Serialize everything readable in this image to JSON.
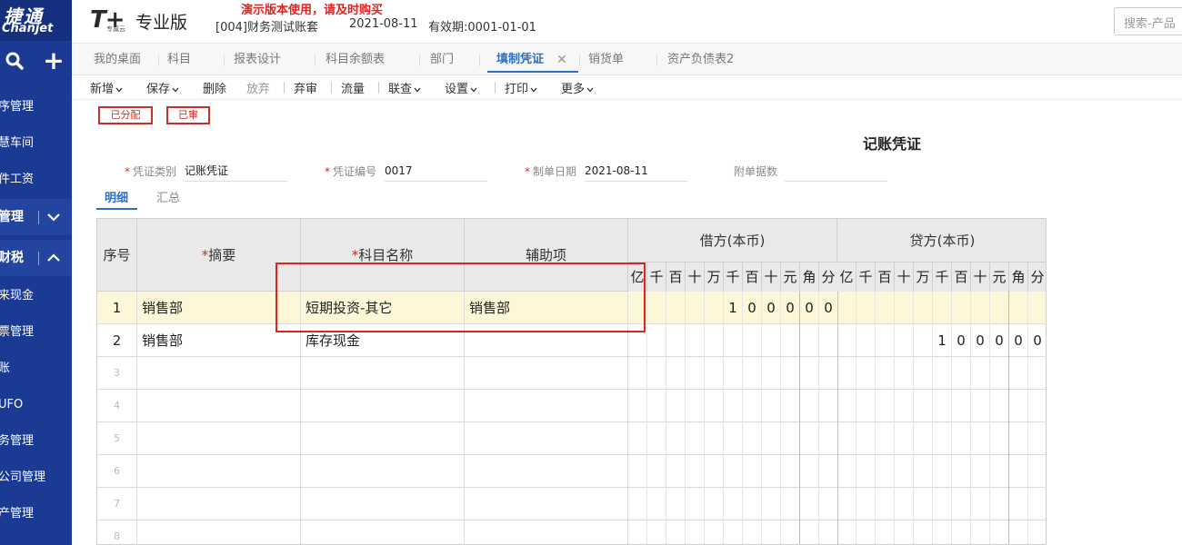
{
  "sidebar": {
    "logo_cn": "捷通",
    "logo_en": "Chanjet",
    "items": [
      {
        "label": "序管理",
        "type": "item"
      },
      {
        "label": "慧车间",
        "type": "item"
      },
      {
        "label": "件工资",
        "type": "item"
      },
      {
        "label": "管理",
        "type": "group",
        "state": "collapsed"
      },
      {
        "label": "财税",
        "type": "group",
        "state": "expanded"
      },
      {
        "label": "来现金",
        "type": "item"
      },
      {
        "label": "票管理",
        "type": "item"
      },
      {
        "label": "账",
        "type": "item"
      },
      {
        "label": "UFO",
        "type": "item"
      },
      {
        "label": "务管理",
        "type": "item"
      },
      {
        "label": "公司管理",
        "type": "item"
      },
      {
        "label": "产管理",
        "type": "item"
      }
    ]
  },
  "header": {
    "brand_mark": "T+",
    "brand_sub": "专属云",
    "edition": "专业版",
    "demo_notice": "演示版本使用，请及时购买",
    "account": "[004]财务测试账套",
    "date": "2021-08-11",
    "validity": "有效期:0001-01-01",
    "search_placeholder": "搜索-产品"
  },
  "tabs": [
    {
      "label": "我的桌面",
      "active": false
    },
    {
      "label": "科目",
      "active": false
    },
    {
      "label": "报表设计",
      "active": false
    },
    {
      "label": "科目余额表",
      "active": false
    },
    {
      "label": "部门",
      "active": false
    },
    {
      "label": "填制凭证",
      "active": true,
      "closable": true
    },
    {
      "label": "销货单",
      "active": false
    },
    {
      "label": "资产负债表2",
      "active": false
    }
  ],
  "toolbar": {
    "new": "新增",
    "save": "保存",
    "delete": "删除",
    "discard": "放弃",
    "abandon": "弃审",
    "flow": "流量",
    "lookup": "联查",
    "settings": "设置",
    "print": "打印",
    "more": "更多"
  },
  "status_badges": [
    "已分配",
    "已审"
  ],
  "voucher": {
    "title": "记账凭证",
    "type_label": "凭证类别",
    "type_value": "记账凭证",
    "number_label": "凭证编号",
    "number_value": "0017",
    "date_label": "制单日期",
    "date_value": "2021-08-11",
    "attach_label": "附单据数",
    "attach_value": ""
  },
  "subtabs": [
    "明细",
    "汇总"
  ],
  "grid": {
    "headers": {
      "seq": "序号",
      "summary": "摘要",
      "account": "科目名称",
      "aux": "辅助项",
      "debit": "借方(本币)",
      "credit": "贷方(本币)"
    },
    "digit_units": [
      "亿",
      "千",
      "百",
      "十",
      "万",
      "千",
      "百",
      "十",
      "元",
      "角",
      "分"
    ],
    "rows": [
      {
        "seq": "1",
        "summary": "销售部",
        "account": "短期投资-其它",
        "aux": "销售部",
        "debit": "100000",
        "credit": "",
        "selected": true
      },
      {
        "seq": "2",
        "summary": "销售部",
        "account": "库存现金",
        "aux": "",
        "debit": "",
        "credit": "100000",
        "selected": false
      },
      {
        "seq": "3",
        "summary": "",
        "account": "",
        "aux": "",
        "debit": "",
        "credit": ""
      },
      {
        "seq": "4",
        "summary": "",
        "account": "",
        "aux": "",
        "debit": "",
        "credit": ""
      },
      {
        "seq": "5",
        "summary": "",
        "account": "",
        "aux": "",
        "debit": "",
        "credit": ""
      },
      {
        "seq": "6",
        "summary": "",
        "account": "",
        "aux": "",
        "debit": "",
        "credit": ""
      },
      {
        "seq": "7",
        "summary": "",
        "account": "",
        "aux": "",
        "debit": "",
        "credit": ""
      },
      {
        "seq": "8",
        "summary": "",
        "account": "",
        "aux": "",
        "debit": "",
        "credit": ""
      }
    ]
  },
  "colors": {
    "sidebar": "#1b3a93",
    "accent": "#2f6fc4",
    "alert": "#e0231e",
    "selected_row": "#fdf6d8"
  }
}
